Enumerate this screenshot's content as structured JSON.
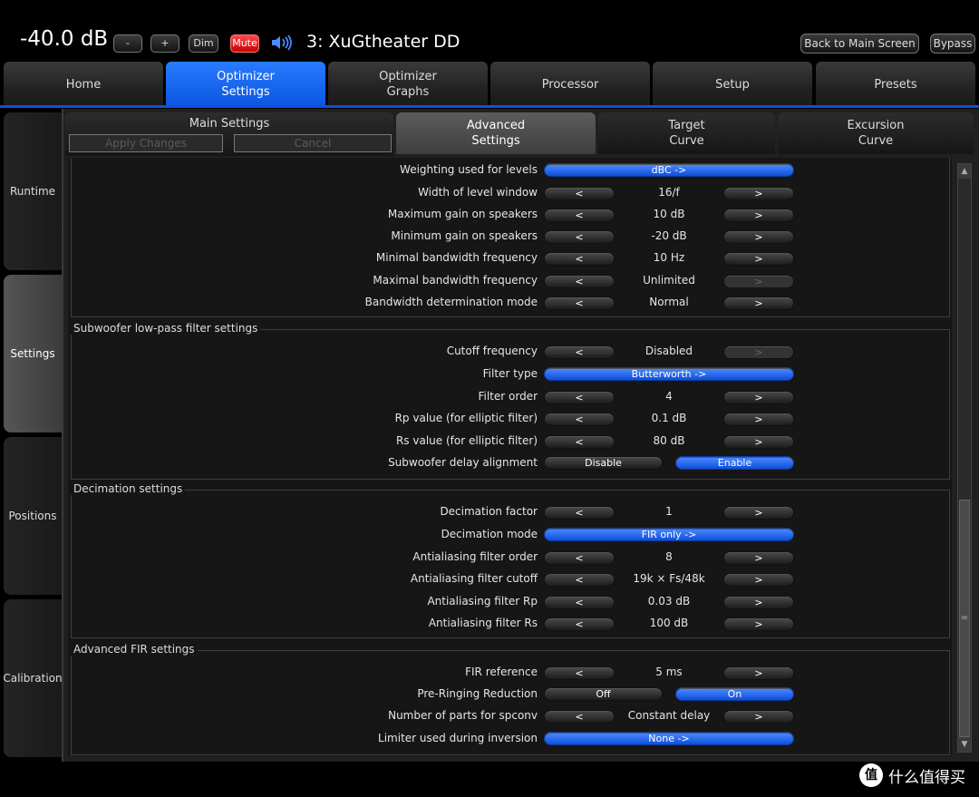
{
  "top": {
    "volume": "-40.0 dB",
    "minus": "-",
    "plus": "+",
    "dim": "Dim",
    "mute": "Mute",
    "input_name": "3: XuGtheater DD",
    "back": "Back to Main Screen",
    "bypass": "Bypass"
  },
  "main_tabs": [
    {
      "line1": "Home",
      "line2": ""
    },
    {
      "line1": "Optimizer",
      "line2": "Settings"
    },
    {
      "line1": "Optimizer",
      "line2": "Graphs"
    },
    {
      "line1": "Processor",
      "line2": ""
    },
    {
      "line1": "Setup",
      "line2": ""
    },
    {
      "line1": "Presets",
      "line2": ""
    }
  ],
  "side_tabs": [
    "Runtime",
    "Settings",
    "Positions",
    "Calibration"
  ],
  "sub_tabs": {
    "main_settings": "Main Settings",
    "apply": "Apply Changes",
    "cancel": "Cancel",
    "advanced1": "Advanced",
    "advanced2": "Settings",
    "target1": "Target",
    "target2": "Curve",
    "excursion1": "Excursion",
    "excursion2": "Curve"
  },
  "groups": {
    "subwoofer": "Subwoofer low-pass filter settings",
    "decimation": "Decimation settings",
    "fir": "Advanced FIR settings"
  },
  "rows": {
    "weighting": {
      "label": "Weighting used for levels",
      "value": "dBC ->"
    },
    "width": {
      "label": "Width of level window",
      "value": "16/f"
    },
    "maxgain": {
      "label": "Maximum gain on speakers",
      "value": "10 dB"
    },
    "mingain": {
      "label": "Minimum gain on speakers",
      "value": "-20 dB"
    },
    "minbw": {
      "label": "Minimal bandwidth frequency",
      "value": "10 Hz"
    },
    "maxbw": {
      "label": "Maximal bandwidth frequency",
      "value": "Unlimited"
    },
    "bwmode": {
      "label": "Bandwidth determination mode",
      "value": "Normal"
    },
    "cutoff": {
      "label": "Cutoff frequency",
      "value": "Disabled"
    },
    "ftype": {
      "label": "Filter type",
      "value": "Butterworth ->"
    },
    "forder": {
      "label": "Filter order",
      "value": "4"
    },
    "rp": {
      "label": "Rp value (for elliptic filter)",
      "value": "0.1 dB"
    },
    "rs": {
      "label": "Rs value (for elliptic filter)",
      "value": "80 dB"
    },
    "subdelay": {
      "label": "Subwoofer delay alignment",
      "opt1": "Disable",
      "opt2": "Enable"
    },
    "decfactor": {
      "label": "Decimation factor",
      "value": "1"
    },
    "decmode": {
      "label": "Decimation mode",
      "value": "FIR only ->"
    },
    "aaorder": {
      "label": "Antialiasing filter order",
      "value": "8"
    },
    "aacutoff": {
      "label": "Antialiasing filter cutoff",
      "value": "19k × Fs/48k"
    },
    "aarp": {
      "label": "Antialiasing filter Rp",
      "value": "0.03 dB"
    },
    "aars": {
      "label": "Antialiasing filter Rs",
      "value": "100 dB"
    },
    "firref": {
      "label": "FIR reference",
      "value": "5 ms"
    },
    "preringing": {
      "label": "Pre-Ringing Reduction",
      "opt1": "Off",
      "opt2": "On"
    },
    "spconv": {
      "label": "Number of parts for spconv",
      "value": "Constant delay"
    },
    "limiter": {
      "label": "Limiter used during inversion",
      "value": "None ->"
    }
  },
  "arrows": {
    "left": "<",
    "right": ">"
  },
  "scroll": {
    "up": "▲",
    "down": "▼",
    "grip": "="
  },
  "watermark": {
    "icon": "值",
    "text": "什么值得买"
  }
}
